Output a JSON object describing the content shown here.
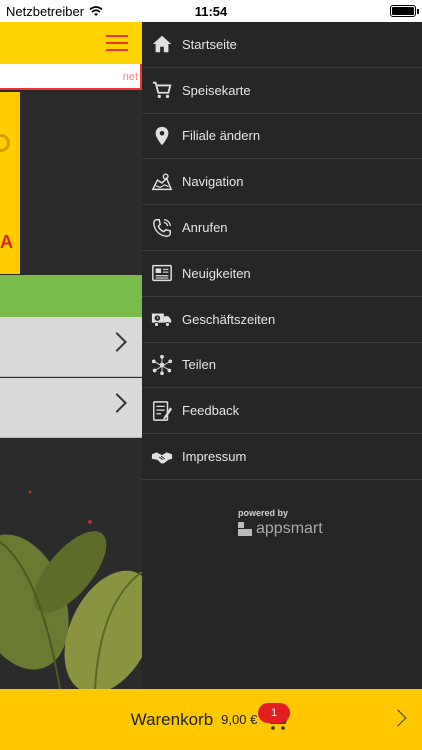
{
  "status_bar": {
    "carrier": "Netzbetreiber",
    "time": "11:54",
    "battery_level": 1.0
  },
  "background_app": {
    "search_placeholder": "net"
  },
  "menu": {
    "items": [
      {
        "label": "Startseite",
        "icon": "home-icon"
      },
      {
        "label": "Speisekarte",
        "icon": "cart-icon"
      },
      {
        "label": "Filiale ändern",
        "icon": "location-pin-icon"
      },
      {
        "label": "Navigation",
        "icon": "map-icon"
      },
      {
        "label": "Anrufen",
        "icon": "phone-icon"
      },
      {
        "label": "Neuigkeiten",
        "icon": "newspaper-icon"
      },
      {
        "label": "Geschäftszeiten",
        "icon": "delivery-truck-icon"
      },
      {
        "label": "Teilen",
        "icon": "share-icon"
      },
      {
        "label": "Feedback",
        "icon": "feedback-icon"
      },
      {
        "label": "Impressum",
        "icon": "handshake-icon"
      }
    ],
    "powered_by": "powered by",
    "brand": "appsmart"
  },
  "cart": {
    "title": "Warenkorb",
    "price": "9,00 €",
    "count": "1"
  },
  "colors": {
    "accent": "#ffc800",
    "menu_bg": "#262626",
    "badge": "#e31e1e",
    "green": "#79bc4c"
  }
}
